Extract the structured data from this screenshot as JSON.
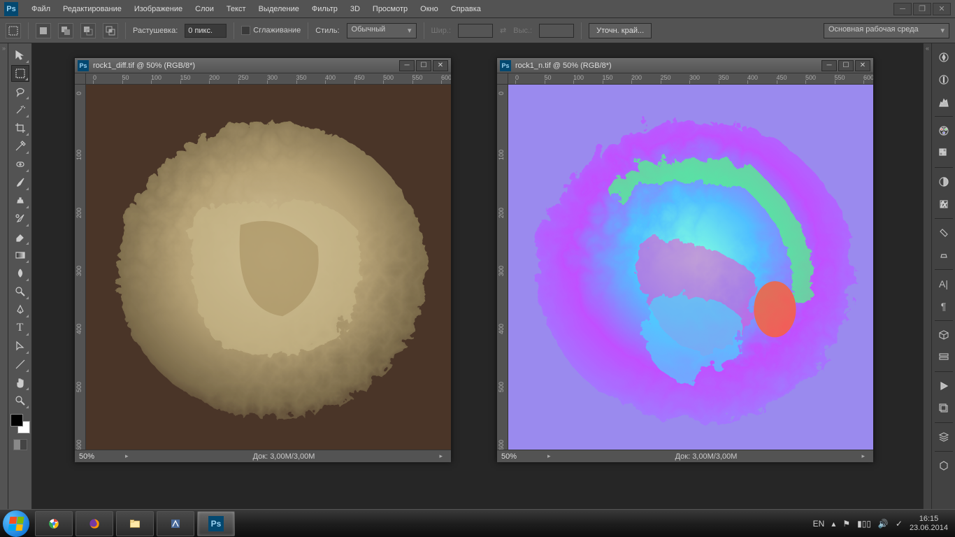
{
  "menu": {
    "items": [
      "Файл",
      "Редактирование",
      "Изображение",
      "Слои",
      "Текст",
      "Выделение",
      "Фильтр",
      "3D",
      "Просмотр",
      "Окно",
      "Справка"
    ]
  },
  "options": {
    "feather_label": "Растушевка:",
    "feather_value": "0 пикс.",
    "antialias_label": "Сглаживание",
    "style_label": "Стиль:",
    "style_value": "Обычный",
    "width_label": "Шир.:",
    "height_label": "Выс.:",
    "refine_label": "Уточн. край...",
    "workspace": "Основная рабочая среда"
  },
  "doc1": {
    "title": "rock1_diff.tif @ 50% (RGB/8*)",
    "zoom": "50%",
    "info": "Док: 3,00M/3,00M",
    "ruler": [
      "0",
      "50",
      "100",
      "150",
      "200",
      "250",
      "300",
      "350",
      "400",
      "450",
      "500",
      "550",
      "600"
    ]
  },
  "doc2": {
    "title": "rock1_n.tif @ 50% (RGB/8*)",
    "zoom": "50%",
    "info": "Док: 3,00M/3,00M"
  },
  "tray": {
    "lang": "EN",
    "time": "16:15",
    "date": "23.06.2014"
  }
}
